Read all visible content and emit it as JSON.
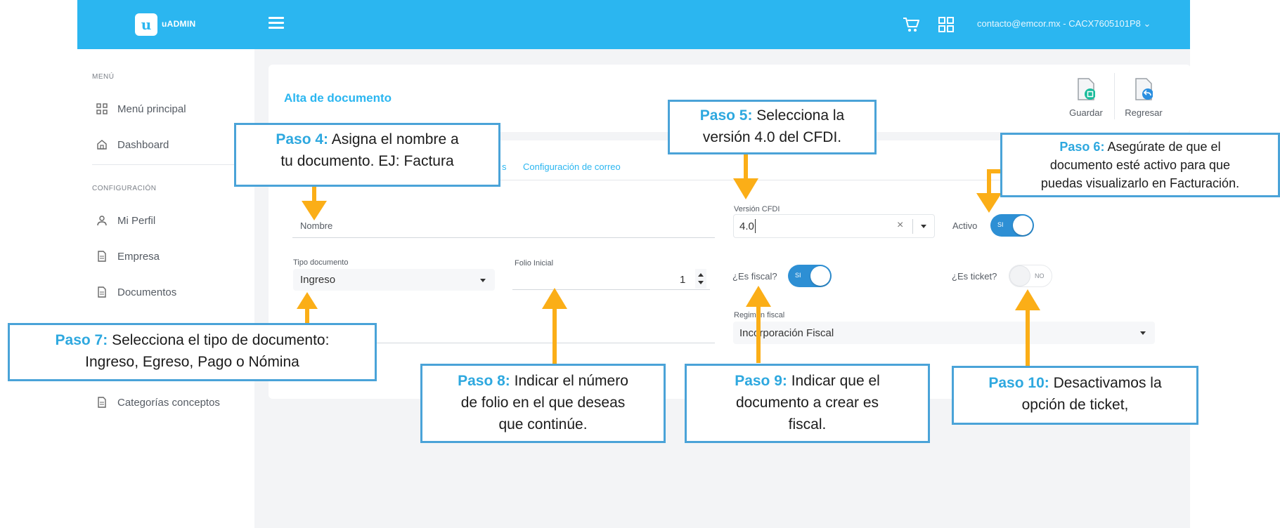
{
  "app": {
    "logo_text": "uADMIN",
    "user": "contacto@emcor.mx - CACX7605101P8"
  },
  "sidebar": {
    "menu_header": "MENÚ",
    "config_header": "CONFIGURACIÓN",
    "items": [
      {
        "label": "Menú principal",
        "icon": "apps-icon"
      },
      {
        "label": "Dashboard",
        "icon": "home-icon"
      },
      {
        "label": "Mi Perfil",
        "icon": "user-icon"
      },
      {
        "label": "Empresa",
        "icon": "document-icon"
      },
      {
        "label": "Documentos",
        "icon": "document-icon"
      },
      {
        "label": "Categorías conceptos",
        "icon": "document-icon"
      }
    ]
  },
  "page": {
    "title": "Alta de documento",
    "save_label": "Guardar",
    "back_label": "Regresar",
    "tab_visible_fragment": "s",
    "tab_email": "Configuración de correo"
  },
  "form": {
    "nombre_label": "Nombre",
    "tipo_label": "Tipo documento",
    "tipo_value": "Ingreso",
    "folio_label": "Folio Inicial",
    "folio_value": "1",
    "version_label": "Versión CFDI",
    "version_value": "4.0",
    "activo_label": "Activo",
    "fiscal_label": "¿Es fiscal?",
    "ticket_label": "¿Es ticket?",
    "toggle_on": "SI",
    "toggle_off": "NO",
    "regimen_label": "Regimen fiscal",
    "regimen_value": "Incorporación Fiscal"
  },
  "callouts": {
    "paso4": {
      "step": "Paso 4:",
      "text1": " Asigna el nombre a",
      "text2": "tu documento. EJ: Factura"
    },
    "paso5": {
      "step": "Paso 5:",
      "text1": " Selecciona la",
      "text2": "versión 4.0 del CFDI."
    },
    "paso6": {
      "step": "Paso 6:",
      "text1": " Asegúrate de que el",
      "text2": "documento esté activo para que",
      "text3": "puedas visualizarlo en Facturación."
    },
    "paso7": {
      "step": "Paso 7:",
      "text1": " Selecciona el tipo de documento:",
      "text2": "Ingreso, Egreso, Pago o Nómina"
    },
    "paso8": {
      "step": "Paso 8:",
      "text1": " Indicar el número",
      "text2": "de folio en el que deseas",
      "text3": "que continúe."
    },
    "paso9": {
      "step": "Paso 9:",
      "text1": " Indicar que el",
      "text2": "documento a crear es",
      "text3": "fiscal."
    },
    "paso10": {
      "step": "Paso 10:",
      "text1": " Desactivamos la",
      "text2": "opción de ticket,"
    }
  },
  "colors": {
    "brand": "#2bb6f0",
    "toggle_on": "#2d8fd4",
    "callout_border": "#4aa3d8",
    "arrow": "#fbae17"
  }
}
